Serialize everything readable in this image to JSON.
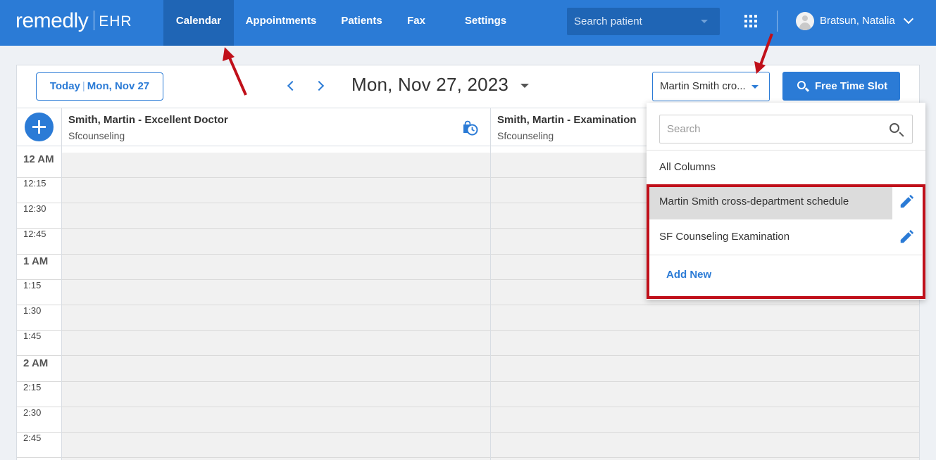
{
  "app": {
    "logo_text": "remedly",
    "logo_suffix": "EHR"
  },
  "nav": {
    "items": [
      {
        "label": "Calendar",
        "active": true
      },
      {
        "label": "Appointments",
        "active": false
      },
      {
        "label": "Patients",
        "active": false
      },
      {
        "label": "Fax",
        "active": false
      },
      {
        "label": "Settings",
        "active": false
      }
    ],
    "search_placeholder": "Search patient",
    "user_name": "Bratsun, Natalia"
  },
  "toolbar": {
    "today_label": "Today",
    "today_date": "Mon, Nov 27",
    "current_date": "Mon, Nov 27, 2023",
    "schedule_selected": "Martin Smith cro...",
    "free_slot_label": "Free Time Slot"
  },
  "columns": [
    {
      "title": "Smith, Martin - Excellent Doctor",
      "subtitle": "Sfcounseling"
    },
    {
      "title": "Smith, Martin - Examination",
      "subtitle": "Sfcounseling"
    }
  ],
  "time_slots": [
    {
      "label": "12 AM",
      "hour": true
    },
    {
      "label": "12:15",
      "hour": false
    },
    {
      "label": "12:30",
      "hour": false
    },
    {
      "label": "12:45",
      "hour": false
    },
    {
      "label": "1 AM",
      "hour": true
    },
    {
      "label": "1:15",
      "hour": false
    },
    {
      "label": "1:30",
      "hour": false
    },
    {
      "label": "1:45",
      "hour": false
    },
    {
      "label": "2 AM",
      "hour": true
    },
    {
      "label": "2:15",
      "hour": false
    },
    {
      "label": "2:30",
      "hour": false
    },
    {
      "label": "2:45",
      "hour": false
    }
  ],
  "schedule_dropdown": {
    "search_placeholder": "Search",
    "all_columns_label": "All Columns",
    "schedules": [
      {
        "label": "Martin Smith cross-department schedule",
        "highlighted": true
      },
      {
        "label": "SF Counseling Examination",
        "highlighted": false
      }
    ],
    "add_new_label": "Add New"
  },
  "colors": {
    "brand_blue": "#2b7bd6",
    "nav_active": "#1f65b5",
    "annotation_red": "#c0101a"
  }
}
